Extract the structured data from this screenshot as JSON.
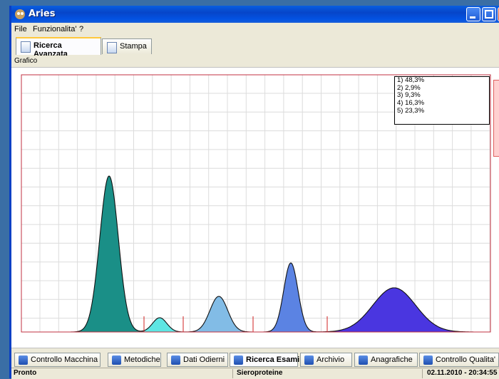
{
  "window": {
    "title": "Aries"
  },
  "menu": {
    "items": [
      "File",
      "Funzionalita'",
      "?"
    ]
  },
  "tabs": [
    {
      "label": "Ricerca Avanzata",
      "active": true
    },
    {
      "label": "Stampa",
      "active": false
    }
  ],
  "panel": {
    "header": "Grafico"
  },
  "chart_data": {
    "type": "area",
    "title": "",
    "legend": {
      "placement": "top-right",
      "entries": [
        "1) 48,3%",
        "2)   2,9%",
        "3)   9,3%",
        "4) 16,3%",
        "5) 23,3%"
      ]
    },
    "grid": true,
    "series": [
      {
        "fraction": "48,3%",
        "color": "#1a8f87"
      },
      {
        "fraction": "2,9%",
        "color": "#5ee6e3"
      },
      {
        "fraction": "9,3%",
        "color": "#82bce6"
      },
      {
        "fraction": "16,3%",
        "color": "#5b83e3"
      },
      {
        "fraction": "23,3%",
        "color": "#4a36e0"
      }
    ]
  },
  "bottom_tabs": [
    {
      "label": "Controllo Macchina",
      "icon": "wrench-icon",
      "active": false
    },
    {
      "label": "Metodiche",
      "icon": "user-icon",
      "active": false
    },
    {
      "label": "Dati Odierni",
      "icon": "chart-icon",
      "active": false
    },
    {
      "label": "Ricerca Esami",
      "icon": "search-icon",
      "active": true
    },
    {
      "label": "Archivio",
      "icon": "archive-icon",
      "active": false
    },
    {
      "label": "Anagrafiche",
      "icon": "folder-icon",
      "active": false
    },
    {
      "label": "Controllo Qualita'",
      "icon": "quality-icon",
      "active": false
    }
  ],
  "status": {
    "left": "Pronto",
    "center": "Sieroproteine",
    "right": "02.11.2010 - 20:34:55"
  }
}
